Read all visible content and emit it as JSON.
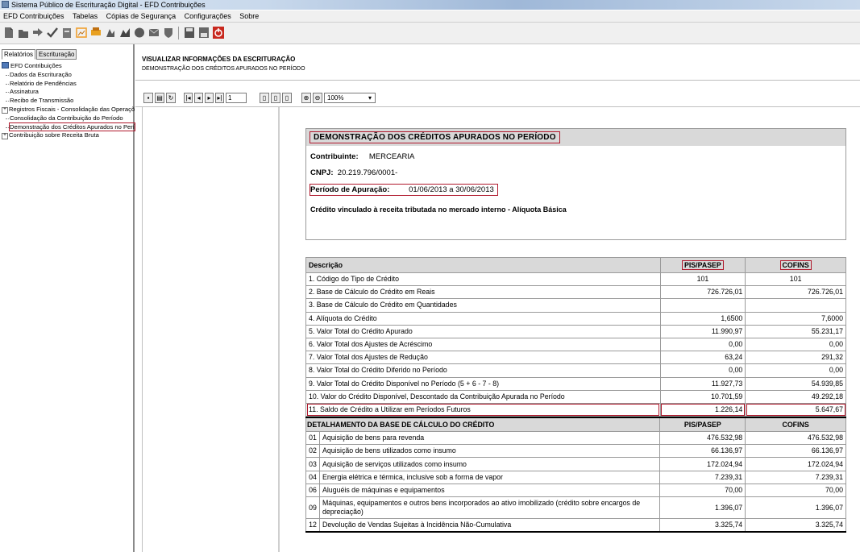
{
  "window": {
    "title": "Sistema Público de Escrituração Digital - EFD Contribuições"
  },
  "menu": [
    "EFD Contribuições",
    "Tabelas",
    "Cópias de Segurança",
    "Configurações",
    "Sobre"
  ],
  "left": {
    "tabs": [
      "Relatórios",
      "Escrituração"
    ],
    "root": "EFD Contribuições",
    "items": [
      "Dados da Escrituração",
      "Relatório de Pendências",
      "Assinatura",
      "Recibo de Transmissão"
    ],
    "expand1": "Registros Fiscais - Consolidação das Operaçõ",
    "item_consolidacao": "Consolidação da Contribuição do Período",
    "item_selected": "Demonstração dos Créditos Apurados no Perí",
    "expand2": "Contribuição sobre Receita Bruta"
  },
  "header": {
    "title": "VISUALIZAR INFORMAÇÕES DA ESCRITURAÇÃO",
    "subtitle": "DEMONSTRAÇÃO DOS CRÉDITOS APURADOS NO PERÍODO"
  },
  "viewer": {
    "page": "1",
    "zoom": "100%"
  },
  "report": {
    "title": "DEMONSTRAÇÃO DOS CRÉDITOS APURADOS NO PERÍODO",
    "contribuinte_label": "Contribuinte:",
    "contribuinte": "MERCEARIA",
    "cnpj_label": "CNPJ:",
    "cnpj": "20.219.796/0001-",
    "periodo_label": "Período de Apuração:",
    "periodo": "01/06/2013 a 30/06/2013",
    "credito": "Crédito vinculado à receita tributada no mercado interno - Alíquota Básica",
    "col_desc": "Descrição",
    "col_pis": "PIS/PASEP",
    "col_cofins": "COFINS",
    "rows": [
      {
        "d": "1. Código do Tipo de Crédito",
        "p": "101",
        "c": "101"
      },
      {
        "d": "2. Base de Cálculo do Crédito em Reais",
        "p": "726.726,01",
        "c": "726.726,01"
      },
      {
        "d": "3. Base de Cálculo do Crédito em Quantidades",
        "p": "",
        "c": ""
      },
      {
        "d": "4. Alíquota do Crédito",
        "p": "1,6500",
        "c": "7,6000"
      },
      {
        "d": "5. Valor Total do Crédito Apurado",
        "p": "11.990,97",
        "c": "55.231,17"
      },
      {
        "d": "6. Valor Total dos Ajustes de Acréscimo",
        "p": "0,00",
        "c": "0,00"
      },
      {
        "d": "7. Valor Total dos Ajustes de Redução",
        "p": "63,24",
        "c": "291,32"
      },
      {
        "d": "8. Valor Total do Crédito Diferido no Período",
        "p": "0,00",
        "c": "0,00"
      },
      {
        "d": "9. Valor Total do Crédito Disponível no Período (5 + 6 - 7 - 8)",
        "p": "11.927,73",
        "c": "54.939,85"
      },
      {
        "d": "10. Valor do Crédito Disponível, Descontado da Contribuição Apurada no Período",
        "p": "10.701,59",
        "c": "49.292,18"
      },
      {
        "d": "11. Saldo de Crédito a Utilizar em Períodos Futuros",
        "p": "1.226,14",
        "c": "5.647,67"
      }
    ],
    "detail_title": "DETALHAMENTO DA BASE DE CÁLCULO DO CRÉDITO",
    "detail_pis": "PIS/PASEP",
    "detail_cofins": "COFINS",
    "details": [
      {
        "cod": "01",
        "d": "Aquisição de bens para revenda",
        "p": "476.532,98",
        "c": "476.532,98"
      },
      {
        "cod": "02",
        "d": "Aquisição de bens utilizados como insumo",
        "p": "66.136,97",
        "c": "66.136,97"
      },
      {
        "cod": "03",
        "d": "Aquisição de serviços utilizados como insumo",
        "p": "172.024,94",
        "c": "172.024,94"
      },
      {
        "cod": "04",
        "d": "Energia elétrica e térmica, inclusive sob a forma de vapor",
        "p": "7.239,31",
        "c": "7.239,31"
      },
      {
        "cod": "06",
        "d": "Aluguéis de máquinas e equipamentos",
        "p": "70,00",
        "c": "70,00"
      },
      {
        "cod": "09",
        "d": "Máquinas, equipamentos e outros bens incorporados ao ativo imobilizado (crédito sobre encargos de",
        "d2": "depreciação)",
        "p": "1.396,07",
        "c": "1.396,07"
      },
      {
        "cod": "12",
        "d": "Devolução de Vendas Sujeitas à Incidência Não-Cumulativa",
        "p": "3.325,74",
        "c": "3.325,74"
      }
    ]
  }
}
